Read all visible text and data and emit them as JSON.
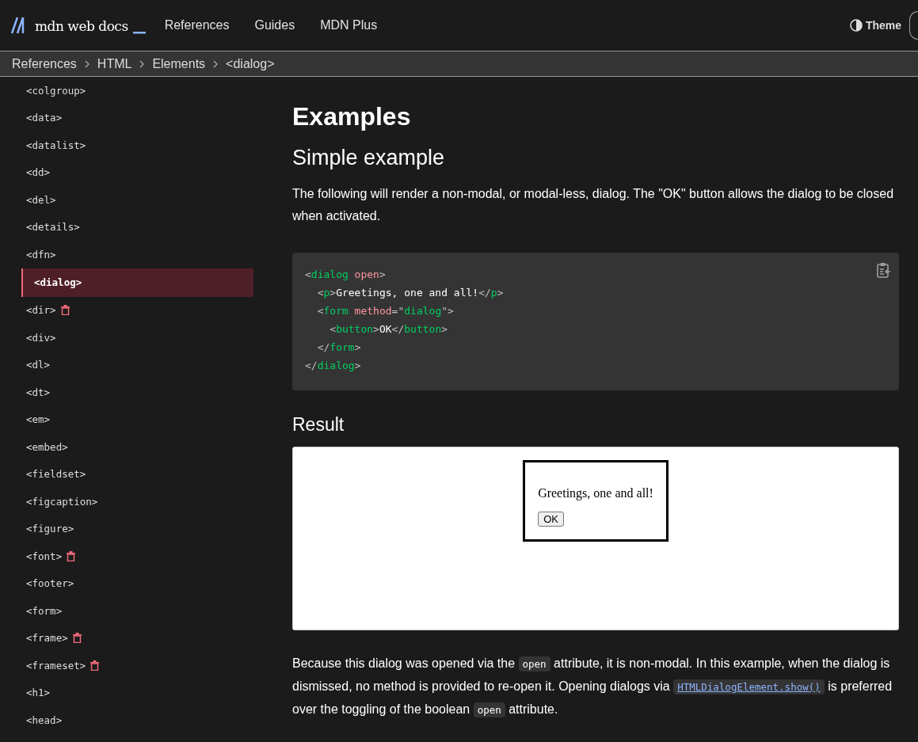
{
  "header": {
    "logo": "mdn web docs",
    "nav": [
      {
        "label": "References"
      },
      {
        "label": "Guides"
      },
      {
        "label": "MDN Plus"
      }
    ],
    "theme": "Theme"
  },
  "breadcrumbs": [
    {
      "label": "References"
    },
    {
      "label": "HTML"
    },
    {
      "label": "Elements"
    },
    {
      "label": "<dialog>"
    }
  ],
  "sidebar": {
    "items": [
      {
        "label": "<colgroup>",
        "selected": false,
        "deprecated": false
      },
      {
        "label": "<data>",
        "selected": false,
        "deprecated": false
      },
      {
        "label": "<datalist>",
        "selected": false,
        "deprecated": false
      },
      {
        "label": "<dd>",
        "selected": false,
        "deprecated": false
      },
      {
        "label": "<del>",
        "selected": false,
        "deprecated": false
      },
      {
        "label": "<details>",
        "selected": false,
        "deprecated": false
      },
      {
        "label": "<dfn>",
        "selected": false,
        "deprecated": false
      },
      {
        "label": "<dialog>",
        "selected": true,
        "deprecated": false
      },
      {
        "label": "<dir>",
        "selected": false,
        "deprecated": true
      },
      {
        "label": "<div>",
        "selected": false,
        "deprecated": false
      },
      {
        "label": "<dl>",
        "selected": false,
        "deprecated": false
      },
      {
        "label": "<dt>",
        "selected": false,
        "deprecated": false
      },
      {
        "label": "<em>",
        "selected": false,
        "deprecated": false
      },
      {
        "label": "<embed>",
        "selected": false,
        "deprecated": false
      },
      {
        "label": "<fieldset>",
        "selected": false,
        "deprecated": false
      },
      {
        "label": "<figcaption>",
        "selected": false,
        "deprecated": false
      },
      {
        "label": "<figure>",
        "selected": false,
        "deprecated": false
      },
      {
        "label": "<font>",
        "selected": false,
        "deprecated": true
      },
      {
        "label": "<footer>",
        "selected": false,
        "deprecated": false
      },
      {
        "label": "<form>",
        "selected": false,
        "deprecated": false
      },
      {
        "label": "<frame>",
        "selected": false,
        "deprecated": true
      },
      {
        "label": "<frameset>",
        "selected": false,
        "deprecated": true
      },
      {
        "label": "<h1>",
        "selected": false,
        "deprecated": false
      },
      {
        "label": "<head>",
        "selected": false,
        "deprecated": false
      }
    ]
  },
  "article": {
    "heading": "Examples",
    "subheading": "Simple example",
    "intro": "The following will render a non-modal, or modal-less, dialog. The \"OK\" button allows the dialog to be closed when activated.",
    "code": [
      [
        {
          "kind": "punct",
          "text": "<"
        },
        {
          "kind": "tag",
          "text": "dialog"
        },
        {
          "kind": "attr",
          "text": " open"
        },
        {
          "kind": "punct",
          "text": ">"
        }
      ],
      [
        {
          "kind": "punct",
          "text": "  <"
        },
        {
          "kind": "tag",
          "text": "p"
        },
        {
          "kind": "punct",
          "text": ">"
        },
        {
          "kind": "text",
          "text": "Greetings, one and all!"
        },
        {
          "kind": "punct",
          "text": "</"
        },
        {
          "kind": "tag",
          "text": "p"
        },
        {
          "kind": "punct",
          "text": ">"
        }
      ],
      [
        {
          "kind": "punct",
          "text": "  <"
        },
        {
          "kind": "tag",
          "text": "form"
        },
        {
          "kind": "attr",
          "text": " method"
        },
        {
          "kind": "punct",
          "text": "=\""
        },
        {
          "kind": "string",
          "text": "dialog"
        },
        {
          "kind": "punct",
          "text": "\">"
        }
      ],
      [
        {
          "kind": "punct",
          "text": "    <"
        },
        {
          "kind": "tag",
          "text": "button"
        },
        {
          "kind": "punct",
          "text": ">"
        },
        {
          "kind": "text",
          "text": "OK"
        },
        {
          "kind": "punct",
          "text": "</"
        },
        {
          "kind": "tag",
          "text": "button"
        },
        {
          "kind": "punct",
          "text": ">"
        }
      ],
      [
        {
          "kind": "punct",
          "text": "  </"
        },
        {
          "kind": "tag",
          "text": "form"
        },
        {
          "kind": "punct",
          "text": ">"
        }
      ],
      [
        {
          "kind": "punct",
          "text": "</"
        },
        {
          "kind": "tag",
          "text": "dialog"
        },
        {
          "kind": "punct",
          "text": ">"
        }
      ]
    ],
    "result_heading": "Result",
    "result": {
      "dialog_text": "Greetings, one and all!",
      "button": "OK"
    },
    "note": [
      {
        "kind": "text",
        "text": "Because this dialog was opened via the "
      },
      {
        "kind": "code",
        "text": "open"
      },
      {
        "kind": "text",
        "text": " attribute, it is non-modal. In this example, when the dialog is dismissed, no method is provided to re-open it. Opening dialogs via "
      },
      {
        "kind": "link",
        "text": "HTMLDialogElement.show()"
      },
      {
        "kind": "text",
        "text": " is preferred over the toggling of the boolean "
      },
      {
        "kind": "code",
        "text": "open"
      },
      {
        "kind": "text",
        "text": " attribute."
      }
    ]
  }
}
